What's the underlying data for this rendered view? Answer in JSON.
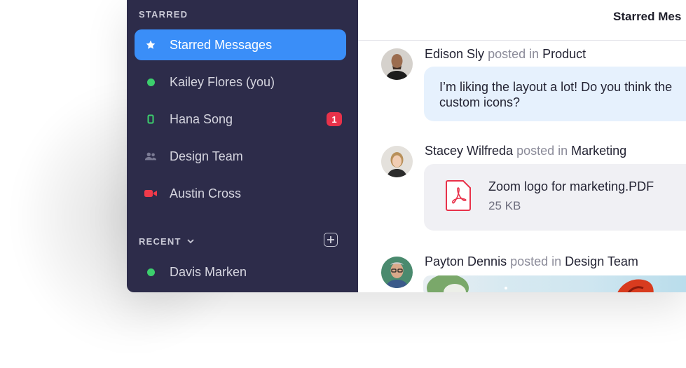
{
  "sidebar": {
    "starred_title": "STARRED",
    "starred_items": [
      {
        "label": "Starred Messages",
        "icon": "star-icon",
        "active": true
      },
      {
        "label": "Kailey Flores  (you)",
        "icon": "online-dot-icon",
        "color": "#3ccf6d"
      },
      {
        "label": "Hana Song",
        "icon": "mobile-icon",
        "color": "#3ccf6d",
        "badge": "1"
      },
      {
        "label": "Design Team",
        "icon": "group-icon",
        "color": "#7b7b94"
      },
      {
        "label": "Austin Cross",
        "icon": "video-camera-icon",
        "color": "#f03a4a"
      }
    ],
    "recent_title": "RECENT",
    "recent_items": [
      {
        "label": "Davis Marken",
        "icon": "online-dot-icon",
        "color": "#3ccf6d"
      }
    ]
  },
  "main": {
    "title": "Starred Mes",
    "posts": [
      {
        "author": "Edison Sly",
        "posted_in": "posted in",
        "channel": "Product",
        "message": "I’m liking the layout a lot! Do you think the\ncustom icons?"
      },
      {
        "author": "Stacey Wilfreda",
        "posted_in": "posted in",
        "channel": "Marketing",
        "file_name": "Zoom logo for marketing.PDF",
        "file_size": "25 KB"
      },
      {
        "author": "Payton Dennis",
        "posted_in": "posted in",
        "channel": "Design Team"
      }
    ]
  },
  "colors": {
    "sidebar_bg": "#2d2c4a",
    "accent": "#3a8ef8",
    "badge": "#e8324a",
    "online": "#3ccf6d",
    "video": "#f03a4a"
  }
}
